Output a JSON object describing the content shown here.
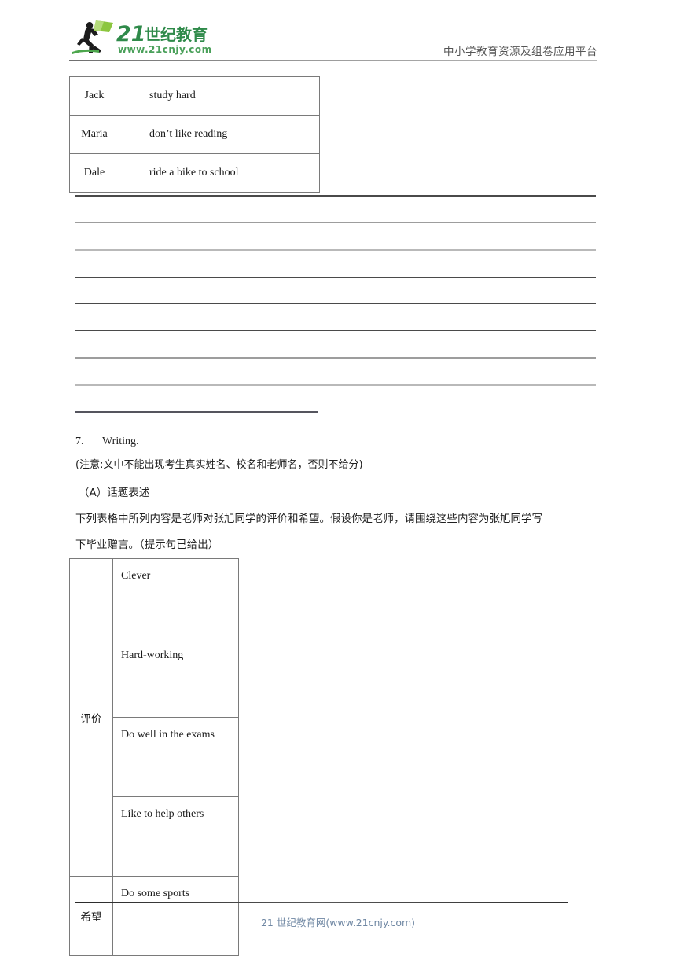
{
  "header": {
    "logo_text_main": "21世纪教育",
    "logo_text_url": "www.21cnjy.com",
    "tagline": "中小学教育资源及组卷应用平台",
    "brand_color": "#3f9c52",
    "brand_color_dark": "#2f7a40"
  },
  "table_names": {
    "rows": [
      {
        "name": "Jack",
        "phrase": "study hard"
      },
      {
        "name": "Maria",
        "phrase": "don’t like reading"
      },
      {
        "name": "Dale",
        "phrase": "ride a bike to school"
      }
    ]
  },
  "writing_lines": {
    "count": 8,
    "short_line": true
  },
  "questions": {
    "number": "7.",
    "title": "Writing.",
    "note": "(注意:文中不能出现考生真实姓名、校名和老师名，否则不给分)",
    "section_a": "（A）话题表述",
    "prompt_line_1": "下列表格中所列内容是老师对张旭同学的评价和希望。假设你是老师，请围绕这些内容为张旭同学写",
    "prompt_line_2": "下毕业赠言。（提示句已给出）"
  },
  "table_evaluation": {
    "label_evaluation": "评价",
    "label_hope": "希望",
    "evaluation_items": [
      "Clever",
      "Hard-working",
      "Do well in the exams",
      "Like to help others"
    ],
    "hope_items": [
      "Do some sports"
    ]
  },
  "footer": {
    "text": "21 世纪教育网(www.21cnjy.com)",
    "color": "#6f87a3"
  }
}
